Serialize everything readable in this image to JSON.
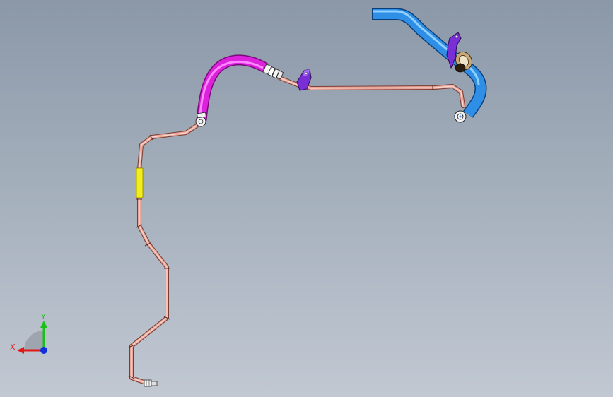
{
  "viewport": {
    "background_top": "#8b98a8",
    "background_bottom": "#c1c8d2"
  },
  "parts": {
    "tube_color": "#e8a79a",
    "hose_color": "#dd22dd",
    "hose_highlight": "#ff88ff",
    "pipe_color": "#2f8fe6",
    "pipe_highlight": "#8fd0ff",
    "bracket_color": "#7a2fd6",
    "marker_color": "#f2ee1e",
    "fitting_color": "#f4f4f4"
  },
  "triad": {
    "x_label": "X",
    "y_label": "Y",
    "x_color": "#e01818",
    "y_color": "#18c018",
    "z_color": "#1030e0"
  }
}
